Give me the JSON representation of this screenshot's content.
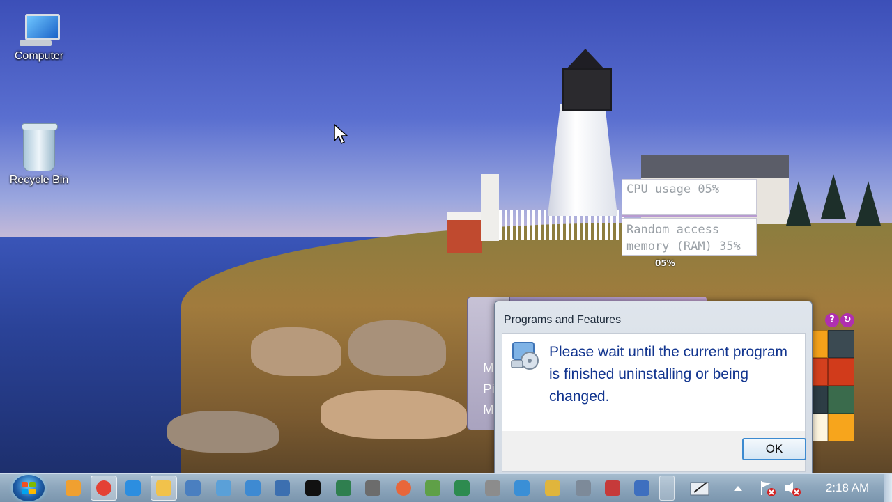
{
  "desktop": {
    "icons": [
      {
        "label": "Computer"
      },
      {
        "label": "Recycle Bin"
      }
    ]
  },
  "gadgets": {
    "cpu_label": "CPU usage 05%",
    "ram_label_line1": "Random access",
    "ram_label_line2": "memory (RAM) 35%",
    "small_percent": "05%"
  },
  "background_window": {
    "fragments": [
      "M",
      "Pi",
      "M"
    ]
  },
  "dialog": {
    "title": "Programs and Features",
    "message": "Please wait until the current program is finished uninstalling or being changed.",
    "ok_label": "OK"
  },
  "taskbar": {
    "pinned": [
      {
        "name": "media-player-icon",
        "color": "#f0a030"
      },
      {
        "name": "chrome-icon",
        "color": "#e44134"
      },
      {
        "name": "internet-explorer-icon",
        "color": "#2c8ee0"
      },
      {
        "name": "file-explorer-icon",
        "color": "#f1c24b"
      },
      {
        "name": "keyboard-app-icon",
        "color": "#4a7fc0"
      },
      {
        "name": "control-panel-icon",
        "color": "#5aa0d8"
      },
      {
        "name": "remote-desktop-icon",
        "color": "#3e8ad2"
      },
      {
        "name": "network-tool-icon",
        "color": "#3c6fb0"
      },
      {
        "name": "7zip-icon",
        "color": "#111111"
      },
      {
        "name": "task-manager-icon",
        "color": "#2f7f4f"
      },
      {
        "name": "server-tool-icon",
        "color": "#6c6c6c"
      },
      {
        "name": "firefox-icon",
        "color": "#e8663a"
      },
      {
        "name": "notepad-plus-icon",
        "color": "#5fa047"
      },
      {
        "name": "calc-spreadsheet-icon",
        "color": "#2d8b4f"
      },
      {
        "name": "printer-icon",
        "color": "#8c8c8c"
      },
      {
        "name": "mail-icon",
        "color": "#3a8fd6"
      },
      {
        "name": "paint-icon",
        "color": "#e0b53c"
      },
      {
        "name": "calculator-icon",
        "color": "#7d8a99"
      },
      {
        "name": "snipping-tool-icon",
        "color": "#c63a3a"
      },
      {
        "name": "uninstall-icon",
        "color": "#3e6fbf"
      }
    ],
    "clock": "2:18 AM"
  }
}
